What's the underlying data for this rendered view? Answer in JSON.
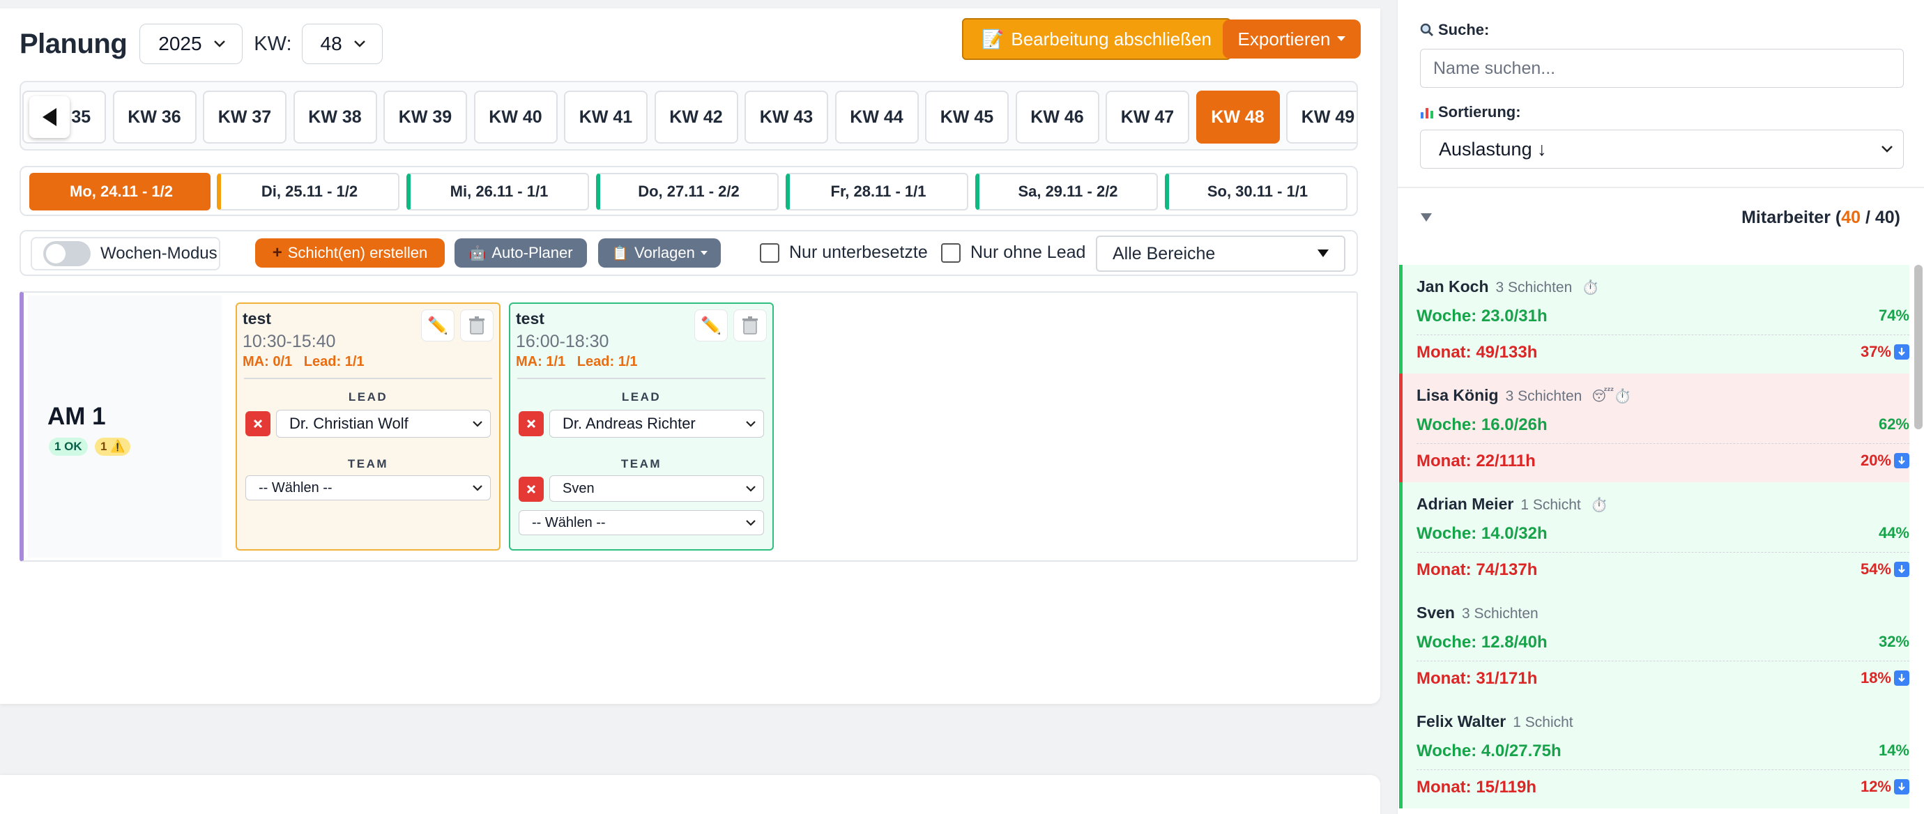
{
  "header": {
    "title": "Planung",
    "year": "2025",
    "kw_label": "KW:",
    "kw_value": "48",
    "finish_button": "Bearbeitung abschließen",
    "export_button": "Exportieren"
  },
  "weeks": [
    "KW 35",
    "KW 36",
    "KW 37",
    "KW 38",
    "KW 39",
    "KW 40",
    "KW 41",
    "KW 42",
    "KW 43",
    "KW 44",
    "KW 45",
    "KW 46",
    "KW 47",
    "KW 48",
    "KW 49"
  ],
  "active_week": "KW 48",
  "days": [
    {
      "label": "Mo, 24.11 - 1/2",
      "status_color": "#f59e0b",
      "active": true
    },
    {
      "label": "Di, 25.11 - 1/2",
      "status_color": "#f59e0b",
      "active": false
    },
    {
      "label": "Mi, 26.11 - 1/1",
      "status_color": "#10b981",
      "active": false
    },
    {
      "label": "Do, 27.11 - 2/2",
      "status_color": "#10b981",
      "active": false
    },
    {
      "label": "Fr, 28.11 - 1/1",
      "status_color": "#10b981",
      "active": false
    },
    {
      "label": "Sa, 29.11 - 2/2",
      "status_color": "#10b981",
      "active": false
    },
    {
      "label": "So, 30.11 - 1/1",
      "status_color": "#10b981",
      "active": false
    }
  ],
  "toolbar": {
    "week_mode_label": "Wochen-Modus",
    "create_shift": "Schicht(en) erstellen",
    "auto_planner": "Auto-Planer",
    "templates": "Vorlagen",
    "only_understaffed": "Nur unterbesetzte",
    "only_no_lead": "Nur ohne Lead",
    "area_select": "Alle Bereiche"
  },
  "row": {
    "title": "AM 1",
    "badge_ok": "1 OK",
    "badge_warn": "1 ⚠️"
  },
  "shifts": [
    {
      "name": "test",
      "time": "10:30-15:40",
      "stats": "MA: 0/1   Lead: 1/1",
      "lead_label": "LEAD",
      "lead": "Dr. Christian Wolf",
      "team_label": "TEAM",
      "team": [
        "-- Wählen --"
      ]
    },
    {
      "name": "test",
      "time": "16:00-18:30",
      "stats": "MA: 1/1   Lead: 1/1",
      "lead_label": "LEAD",
      "lead": "Dr. Andreas Richter",
      "team_label": "TEAM",
      "team": [
        "Sven",
        "-- Wählen --"
      ]
    }
  ],
  "sidebar": {
    "search_label": "Suche:",
    "search_placeholder": "Name suchen...",
    "sort_label": "Sortierung:",
    "sort_value": "Auslastung ↓",
    "employees_label": "Mitarbeiter (",
    "employees_shown": "40",
    "employees_total": " / 40)",
    "employees": [
      {
        "name": "Jan Koch",
        "shifts": "3 Schichten",
        "flags": "⏱️",
        "week": "Woche: 23.0/31h",
        "week_pct": "74%",
        "month": "Monat: 49/133h",
        "month_pct": "37%",
        "state": "good"
      },
      {
        "name": "Lisa König",
        "shifts": "3 Schichten",
        "flags": "😴⏱️",
        "week": "Woche: 16.0/26h",
        "week_pct": "62%",
        "month": "Monat: 22/111h",
        "month_pct": "20%",
        "state": "bad"
      },
      {
        "name": "Adrian Meier",
        "shifts": "1 Schicht",
        "flags": "⏱️",
        "week": "Woche: 14.0/32h",
        "week_pct": "44%",
        "month": "Monat: 74/137h",
        "month_pct": "54%",
        "state": "good"
      },
      {
        "name": "Sven",
        "shifts": "3 Schichten",
        "flags": "",
        "week": "Woche: 12.8/40h",
        "week_pct": "32%",
        "month": "Monat: 31/171h",
        "month_pct": "18%",
        "state": "good"
      },
      {
        "name": "Felix Walter",
        "shifts": "1 Schicht",
        "flags": "",
        "week": "Woche: 4.0/27.75h",
        "week_pct": "14%",
        "month": "Monat: 15/119h",
        "month_pct": "12%",
        "state": "good"
      }
    ]
  },
  "colors": {
    "accent": "#ea6c10",
    "finish": "#f59e0b",
    "good": "#16a34a",
    "bad": "#dc2626"
  }
}
